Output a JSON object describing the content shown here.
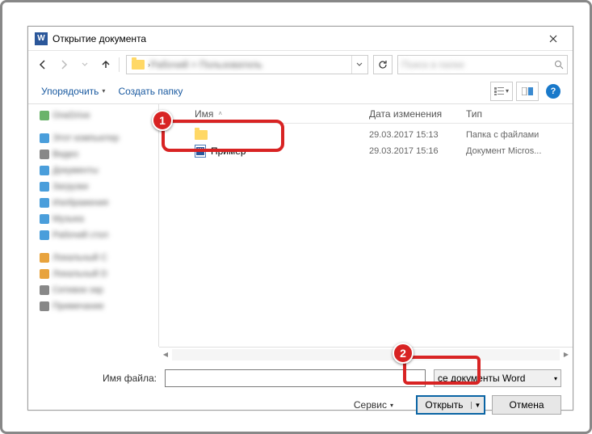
{
  "title": "Открытие документа",
  "nav": {
    "back": "←",
    "forward": "→",
    "up": "↑",
    "refresh": "⟳"
  },
  "breadcrumb_blur": "Рабочий > Пользователь",
  "search_blur": "Поиск в папке",
  "toolbar": {
    "organize": "Упорядочить",
    "new_folder": "Создать папку"
  },
  "columns": {
    "name": "Имя",
    "date": "Дата изменения",
    "type": "Тип"
  },
  "sidebar_items": [
    {
      "color": "green",
      "text": "OneDrive"
    },
    {
      "color": "blue",
      "text": "Этот компьютер"
    },
    {
      "color": "gray",
      "text": "Видео"
    },
    {
      "color": "blue",
      "text": "Документы"
    },
    {
      "color": "blue",
      "text": "Загрузки"
    },
    {
      "color": "blue",
      "text": "Изображения"
    },
    {
      "color": "blue",
      "text": "Музыка"
    },
    {
      "color": "blue",
      "text": "Рабочий стол"
    },
    {
      "color": "orange",
      "text": "Локальный C"
    },
    {
      "color": "orange",
      "text": "Локальный D"
    },
    {
      "color": "gray",
      "text": "Сетевое окр"
    },
    {
      "color": "gray",
      "text": "Примечание"
    }
  ],
  "files": [
    {
      "name": "",
      "date": "29.03.2017 15:13",
      "type": "Папка с файлами",
      "icon": "folder"
    },
    {
      "name": "Пример",
      "date": "29.03.2017 15:16",
      "type": "Документ Micros...",
      "icon": "doc"
    }
  ],
  "footer": {
    "filename_label": "Имя файла:",
    "filename_value": "",
    "filter": "се документы Word",
    "service": "Сервис",
    "open": "Открыть",
    "cancel": "Отмена"
  },
  "markers": {
    "one": "1",
    "two": "2"
  }
}
